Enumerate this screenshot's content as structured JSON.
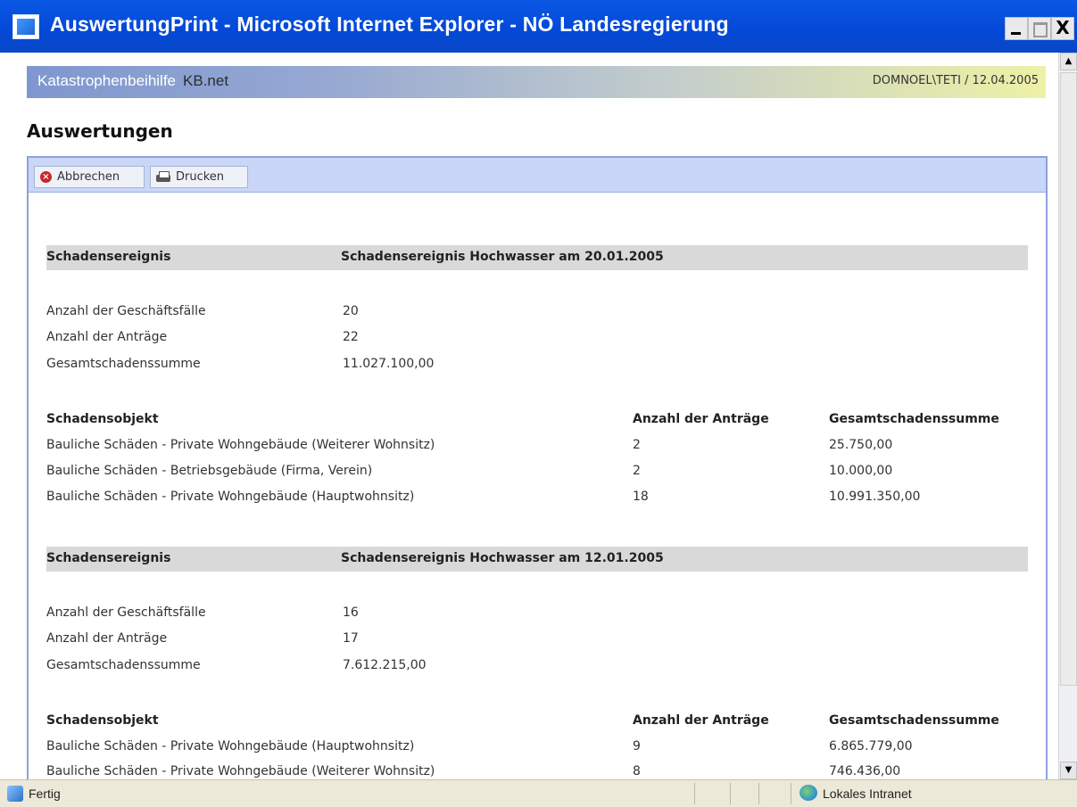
{
  "window": {
    "title": "AuswertungPrint - Microsoft Internet Explorer - NÖ Landesregierung",
    "min_label": "_",
    "close_label": "X"
  },
  "app": {
    "name": "Katastrophenbeihilfe",
    "product": "KB.net",
    "user_date": "DOMNOEL\\TETI / 12.04.2005"
  },
  "page": {
    "title": "Auswertungen"
  },
  "toolbar": {
    "cancel_label": "Abbrechen",
    "print_label": "Drucken"
  },
  "labels": {
    "event": "Schadensereignis",
    "cases": "Anzahl der Geschäftsfälle",
    "applications": "Anzahl der Anträge",
    "total": "Gesamtschadenssumme",
    "object": "Schadensobjekt",
    "obj_applications": "Anzahl der Anträge",
    "obj_total": "Gesamtschadenssumme"
  },
  "events": [
    {
      "name": "Schadensereignis Hochwasser am 20.01.2005",
      "cases": "20",
      "applications": "22",
      "total": "11.027.100,00",
      "objects": [
        {
          "name": "Bauliche Schäden - Private Wohngebäude (Weiterer Wohnsitz)",
          "count": "2",
          "sum": "25.750,00"
        },
        {
          "name": "Bauliche Schäden - Betriebsgebäude (Firma, Verein)",
          "count": "2",
          "sum": "10.000,00"
        },
        {
          "name": "Bauliche Schäden - Private Wohngebäude (Hauptwohnsitz)",
          "count": "18",
          "sum": "10.991.350,00"
        }
      ]
    },
    {
      "name": "Schadensereignis Hochwasser am 12.01.2005",
      "cases": "16",
      "applications": "17",
      "total": "7.612.215,00",
      "objects": [
        {
          "name": "Bauliche Schäden - Private Wohngebäude (Hauptwohnsitz)",
          "count": "9",
          "sum": "6.865.779,00"
        },
        {
          "name": "Bauliche Schäden - Private Wohngebäude (Weiterer Wohnsitz)",
          "count": "8",
          "sum": "746.436,00"
        }
      ]
    }
  ],
  "status": {
    "text": "Fertig",
    "zone": "Lokales Intranet"
  }
}
